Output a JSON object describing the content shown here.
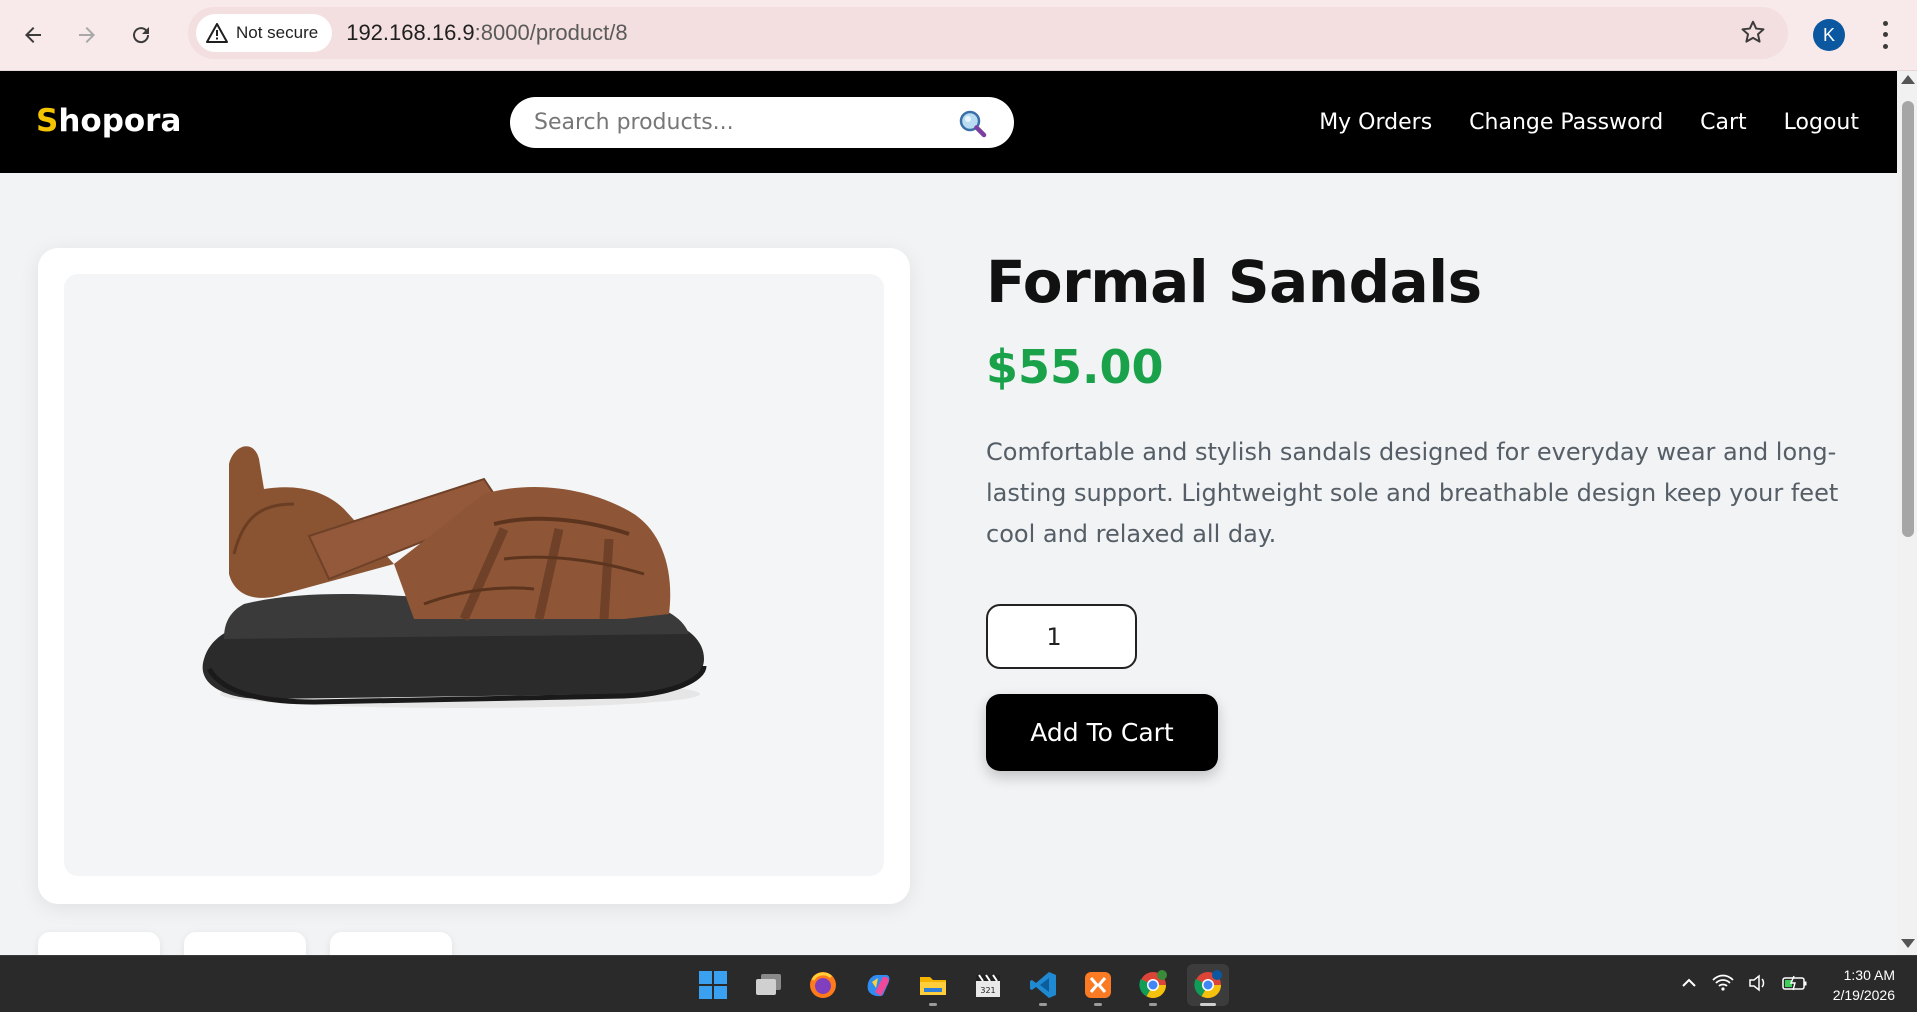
{
  "browser": {
    "security_label": "Not secure",
    "url_host": "192.168.16.9",
    "url_path": ":8000/product/8",
    "profile_initial": "K",
    "icons": [
      "back-icon",
      "forward-icon",
      "reload-icon",
      "warning-icon",
      "star-icon",
      "kebab-menu-icon"
    ]
  },
  "site": {
    "logo_first": "S",
    "logo_rest": "hopora",
    "search_placeholder": "Search products...",
    "nav": [
      "My Orders",
      "Change Password",
      "Cart",
      "Logout"
    ],
    "colors": {
      "header_bg": "#000000",
      "logo_accent": "#f5c400",
      "price": "#19a24a"
    }
  },
  "product": {
    "title": "Formal Sandals",
    "price": "$55.00",
    "description": "Comfortable and stylish sandals designed for everyday wear and long-lasting support. Lightweight sole and breathable design keep your feet cool and relaxed all day.",
    "quantity": "1",
    "add_to_cart_label": "Add To Cart",
    "image_alt": "brown sandal"
  },
  "taskbar": {
    "apps": [
      "windows-start-icon",
      "task-view-icon",
      "firefox-icon",
      "copilot-icon",
      "file-explorer-icon",
      "clapperboard-icon",
      "vscode-icon",
      "xampp-icon",
      "chrome-icon",
      "chrome-profile-icon"
    ],
    "time": "1:30 AM",
    "date": "2/19/2026"
  }
}
